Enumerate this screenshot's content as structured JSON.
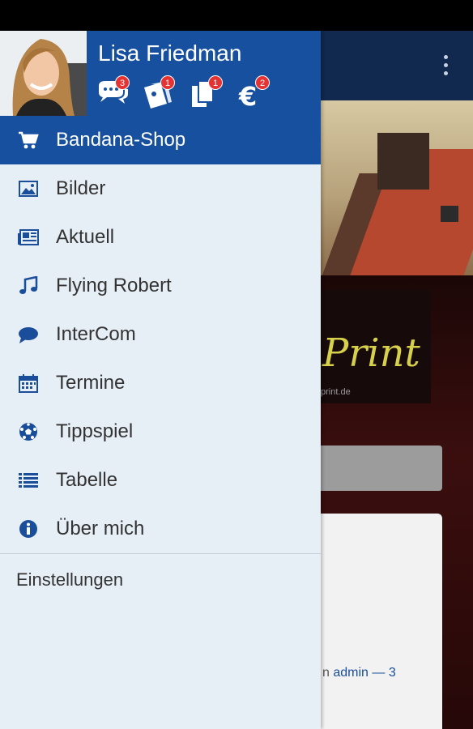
{
  "background": {
    "logo_text": "Print",
    "logo_sub": "print.de",
    "card_text_prefix": "n ",
    "card_link": "admin",
    "card_text_suffix": " — 3"
  },
  "drawer": {
    "user_name": "Lisa Friedman",
    "stats": [
      {
        "icon": "chat-bubbles-icon",
        "count": "3"
      },
      {
        "icon": "tickets-icon",
        "count": "1"
      },
      {
        "icon": "documents-icon",
        "count": "1"
      },
      {
        "icon": "euro-icon",
        "count": "2"
      }
    ],
    "items": [
      {
        "label": "Bandana-Shop",
        "icon": "cart-icon"
      },
      {
        "label": "Bilder",
        "icon": "image-icon"
      },
      {
        "label": "Aktuell",
        "icon": "newspaper-icon"
      },
      {
        "label": "Flying Robert",
        "icon": "music-note-icon"
      },
      {
        "label": "InterCom",
        "icon": "chat-icon"
      },
      {
        "label": "Termine",
        "icon": "calendar-icon"
      },
      {
        "label": "Tippspiel",
        "icon": "soccer-ball-icon"
      },
      {
        "label": "Tabelle",
        "icon": "list-icon"
      },
      {
        "label": "Über mich",
        "icon": "info-icon"
      }
    ],
    "settings_label": "Einstellungen"
  },
  "colors": {
    "accent": "#1850a0",
    "drawer_bg": "#e6eef6",
    "icon": "#1a4d9a",
    "badge": "#e53333"
  }
}
